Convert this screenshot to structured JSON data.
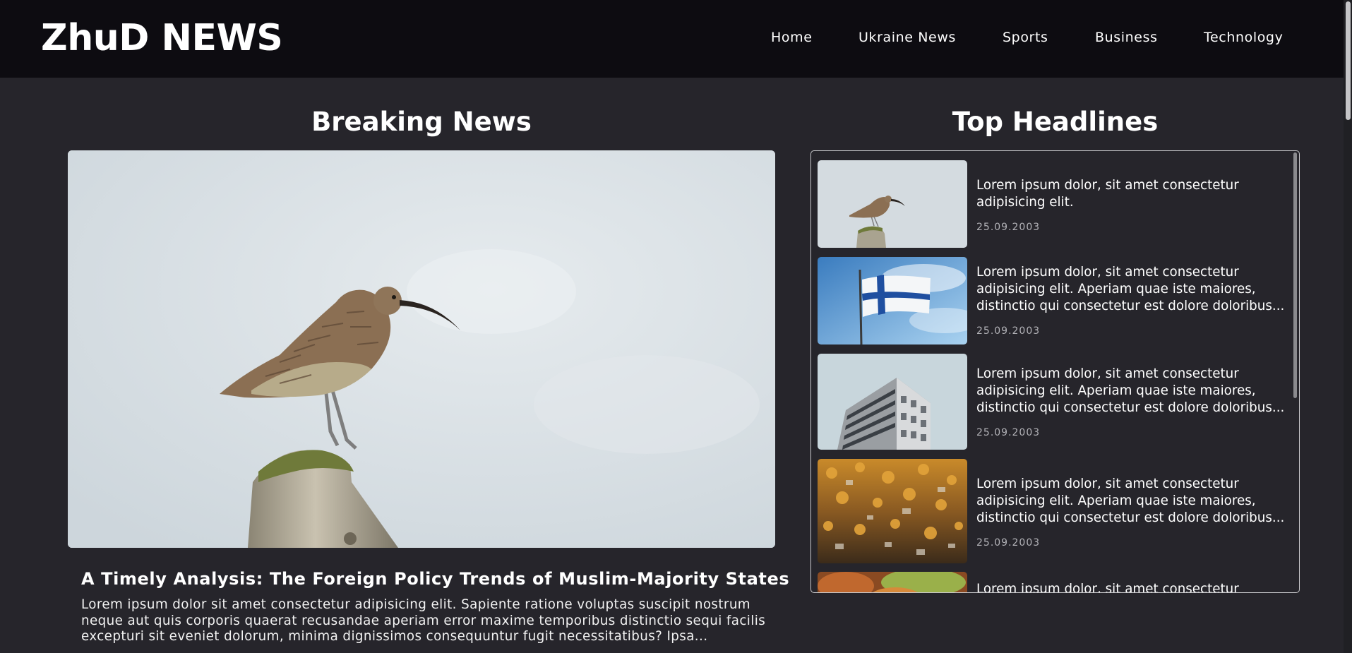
{
  "header": {
    "logo": "ZhuD NEWS",
    "nav": [
      "Home",
      "Ukraine News",
      "Sports",
      "Business",
      "Technology"
    ]
  },
  "breaking": {
    "title": "Breaking News",
    "headline": "A Timely Analysis: The Foreign Policy Trends of Muslim-Majority States",
    "text": "Lorem ipsum dolor sit amet consectetur adipisicing elit. Sapiente ratione voluptas suscipit nostrum neque aut quis corporis quaerat recusandae aperiam error maxime temporibus distinctio sequi facilis excepturi sit eveniet dolorum, minima dignissimos consequuntur fugit necessitatibus? Ipsa..."
  },
  "top": {
    "title": "Top Headlines",
    "items": [
      {
        "title": "Lorem ipsum dolor, sit amet consectetur adipisicing elit.",
        "date": "25.09.2003",
        "image": "bird"
      },
      {
        "title": "Lorem ipsum dolor, sit amet consectetur adipisicing elit. Aperiam quae iste maiores, distinctio qui consectetur est dolore doloribus...",
        "date": "25.09.2003",
        "image": "finland-flag"
      },
      {
        "title": "Lorem ipsum dolor, sit amet consectetur adipisicing elit. Aperiam quae iste maiores, distinctio qui consectetur est dolore doloribus...",
        "date": "25.09.2003",
        "image": "building"
      },
      {
        "title": "Lorem ipsum dolor, sit amet consectetur adipisicing elit. Aperiam quae iste maiores, distinctio qui consectetur est dolore doloribus...",
        "date": "25.09.2003",
        "image": "city-aerial"
      },
      {
        "title": "Lorem ipsum dolor, sit amet consectetur",
        "date": "",
        "image": "autumn"
      }
    ]
  }
}
